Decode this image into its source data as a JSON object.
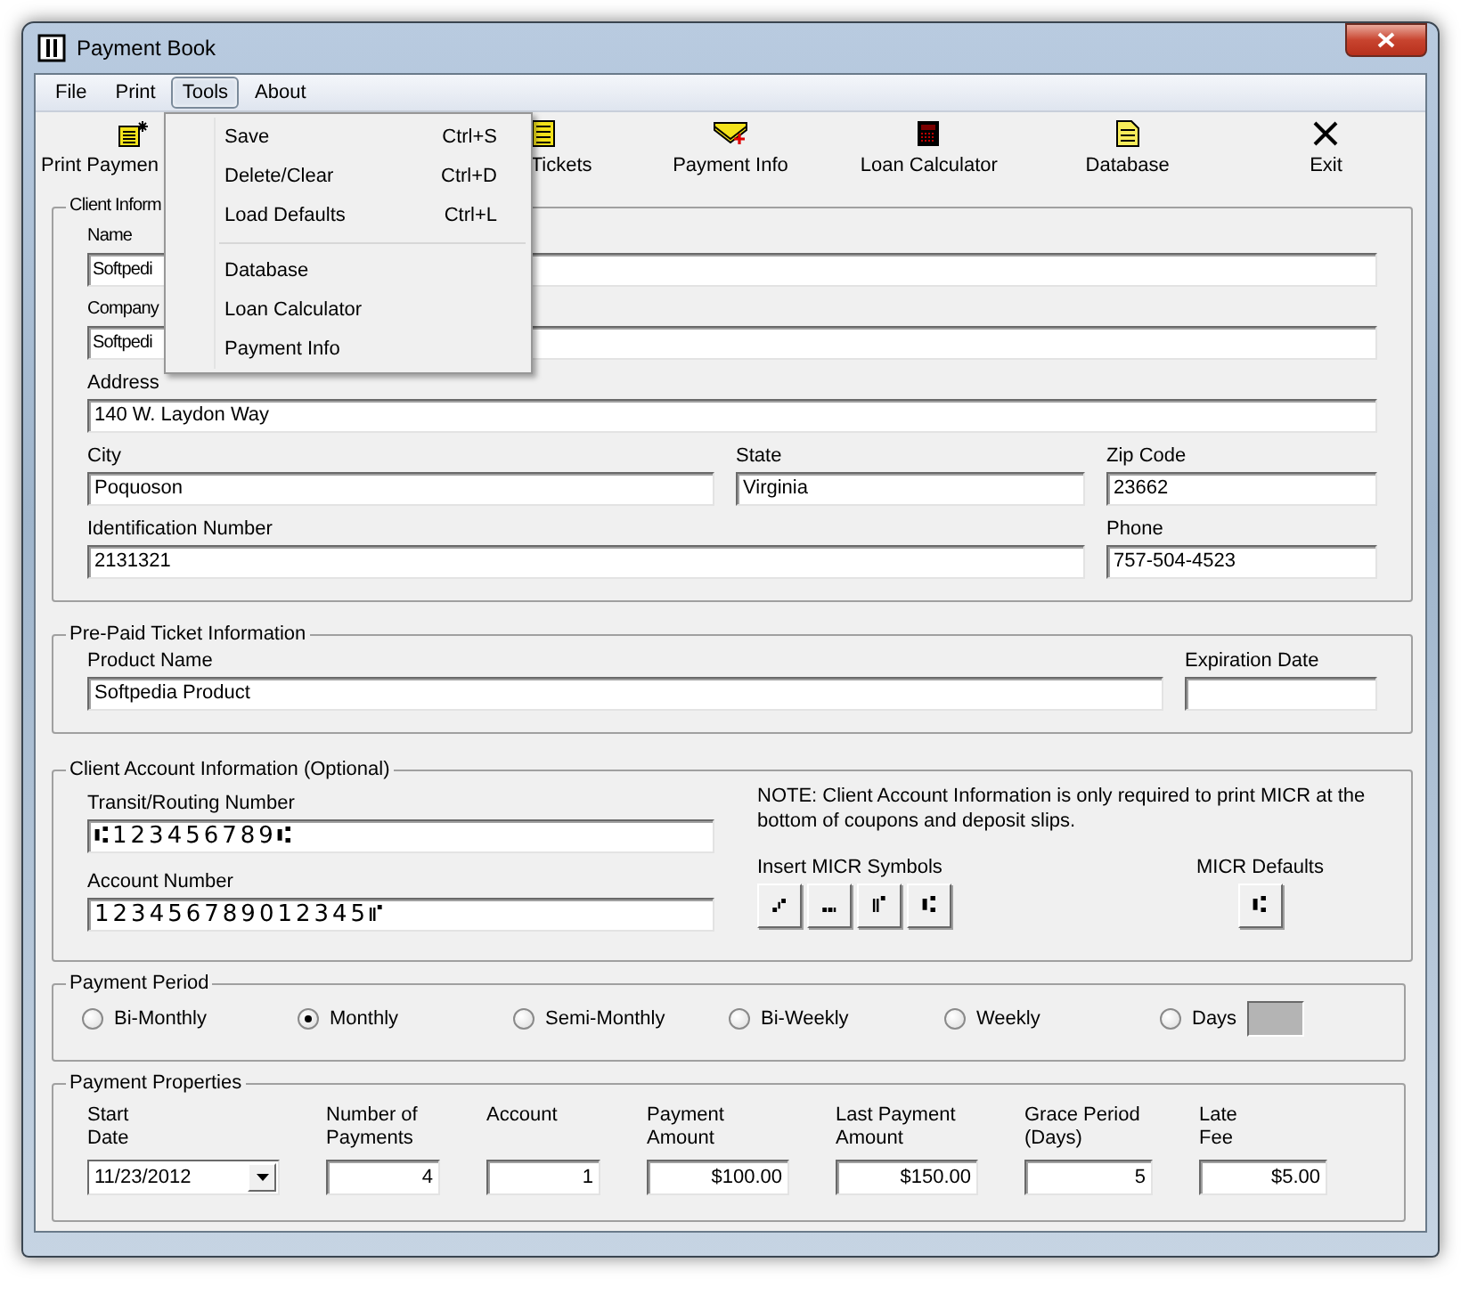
{
  "window": {
    "title": "Payment Book"
  },
  "menu_bar": [
    {
      "label": "File",
      "selected": false
    },
    {
      "label": "Print",
      "selected": false
    },
    {
      "label": "Tools",
      "selected": true
    },
    {
      "label": "About",
      "selected": false
    }
  ],
  "tools_menu": {
    "groups": [
      [
        {
          "label": "Save",
          "shortcut": "Ctrl+S"
        },
        {
          "label": "Delete/Clear",
          "shortcut": "Ctrl+D"
        },
        {
          "label": "Load Defaults",
          "shortcut": "Ctrl+L"
        }
      ],
      [
        {
          "label": "Database"
        },
        {
          "label": "Loan Calculator"
        },
        {
          "label": "Payment Info"
        }
      ]
    ]
  },
  "toolbar": [
    {
      "label": "Print Paymen"
    },
    {
      "label": "Tickets"
    },
    {
      "label": "Payment Info"
    },
    {
      "label": "Loan Calculator"
    },
    {
      "label": "Database"
    },
    {
      "label": "Exit"
    }
  ],
  "client_information": {
    "title": "Client Inform",
    "fields": [
      {
        "label": "Name",
        "value": "Softpedi"
      },
      {
        "label": "Company",
        "value": "Softpedi"
      },
      {
        "label": "Address",
        "value": "140 W. Laydon Way"
      },
      {
        "label": "City",
        "value": "Poquoson"
      },
      {
        "label": "State",
        "value": "Virginia"
      },
      {
        "label": "Zip Code",
        "value": "23662"
      },
      {
        "label": "Identification Number",
        "value": "2131321"
      },
      {
        "label": "Phone",
        "value": "757-504-4523"
      }
    ]
  },
  "prepaid_ticket_information": {
    "title": "Pre-Paid Ticket Information",
    "fields": [
      {
        "label": "Product Name",
        "value": "Softpedia Product"
      },
      {
        "label": "Expiration Date"
      }
    ]
  },
  "client_account_information": {
    "title": "Client Account Information (Optional)",
    "fields": [
      {
        "label": "Transit/Routing Number",
        "value": "⑆123456789⑆"
      },
      {
        "label": "Account Number",
        "value": "123456789012345⑈"
      }
    ],
    "note": "NOTE:  Client Account Information is only required to print MICR at the bottom of coupons and deposit slips.",
    "insert_micr_symbols": {
      "label": "Insert MICR Symbols",
      "buttons": [
        "⑇",
        "⑉",
        "⑈",
        "⑆"
      ]
    },
    "micr_defaults": {
      "label": "MICR Defaults",
      "button": "⑆"
    }
  },
  "payment_period": {
    "title": "Payment Period",
    "options": [
      {
        "label": "Bi-Monthly",
        "selected": false
      },
      {
        "label": "Monthly",
        "selected": true
      },
      {
        "label": "Semi-Monthly",
        "selected": false
      },
      {
        "label": "Bi-Weekly",
        "selected": false
      },
      {
        "label": "Weekly",
        "selected": false
      },
      {
        "label": "Days",
        "selected": false
      }
    ],
    "days_field": {
      "disabled": true
    }
  },
  "payment_properties": {
    "title": "Payment Properties",
    "fields": [
      {
        "label": "Start\nDate",
        "value": "11/23/2012",
        "kind": "date"
      },
      {
        "label": "Number of\nPayments",
        "value": "4",
        "kind": "number"
      },
      {
        "label": "Account",
        "value": "1",
        "kind": "number"
      },
      {
        "label": "Payment\nAmount",
        "value": "$100.00",
        "kind": "number"
      },
      {
        "label": "Last Payment\nAmount",
        "value": "$150.00",
        "kind": "number"
      },
      {
        "label": "Grace Period\n(Days)",
        "value": "5",
        "kind": "number"
      },
      {
        "label": "Late\nFee",
        "value": "$5.00",
        "kind": "number"
      }
    ]
  }
}
